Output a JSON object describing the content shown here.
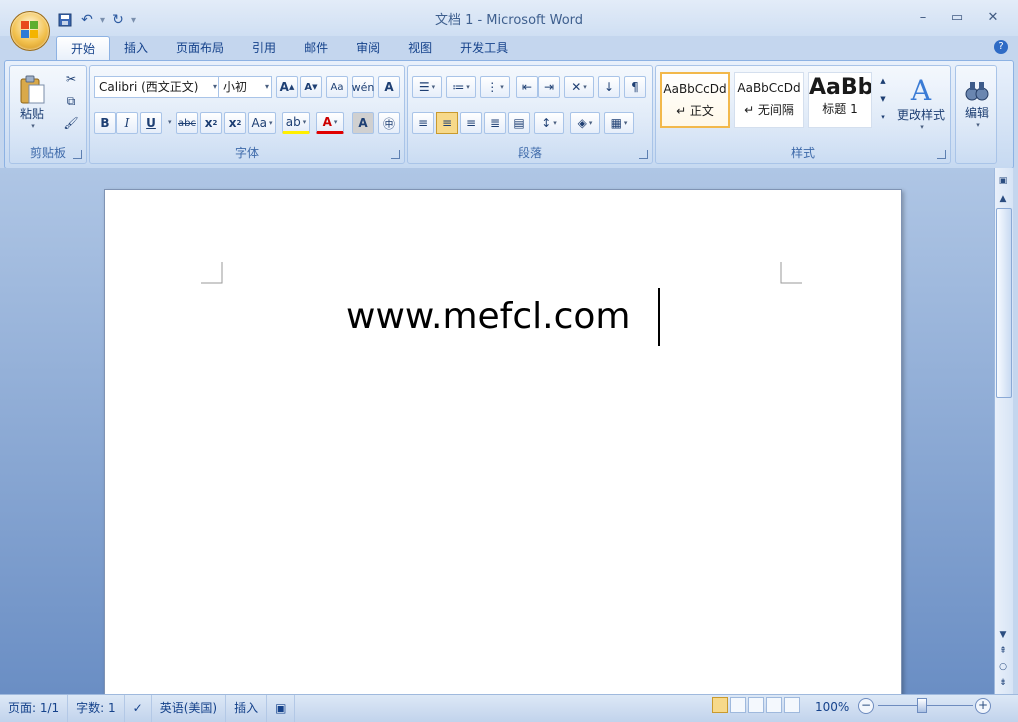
{
  "window": {
    "title": "文档 1 - Microsoft Word"
  },
  "qat": {
    "customize_glyph": "▾"
  },
  "tabs": [
    {
      "label": "开始"
    },
    {
      "label": "插入"
    },
    {
      "label": "页面布局"
    },
    {
      "label": "引用"
    },
    {
      "label": "邮件"
    },
    {
      "label": "审阅"
    },
    {
      "label": "视图"
    },
    {
      "label": "开发工具"
    }
  ],
  "ribbon": {
    "clipboard": {
      "label": "剪贴板",
      "paste_label": "粘贴"
    },
    "font": {
      "label": "字体",
      "font_name": "Calibri (西文正文)",
      "font_size": "小初"
    },
    "paragraph": {
      "label": "段落"
    },
    "styles": {
      "label": "样式",
      "cards": [
        {
          "sample": "AaBbCcDd",
          "name": "↵ 正文"
        },
        {
          "sample": "AaBbCcDd",
          "name": "↵ 无间隔"
        },
        {
          "sample": "AaBb",
          "name": "标题 1"
        }
      ],
      "change_styles_label": "更改样式"
    },
    "editing": {
      "label": "编辑"
    }
  },
  "document": {
    "text": "www.mefcl.com"
  },
  "status": {
    "page": "页面: 1/1",
    "words": "字数: 1",
    "language": "英语(美国)",
    "mode": "插入",
    "zoom": "100%"
  },
  "colors": {
    "accent": "#15428b",
    "highlight": "#f2b84b"
  }
}
